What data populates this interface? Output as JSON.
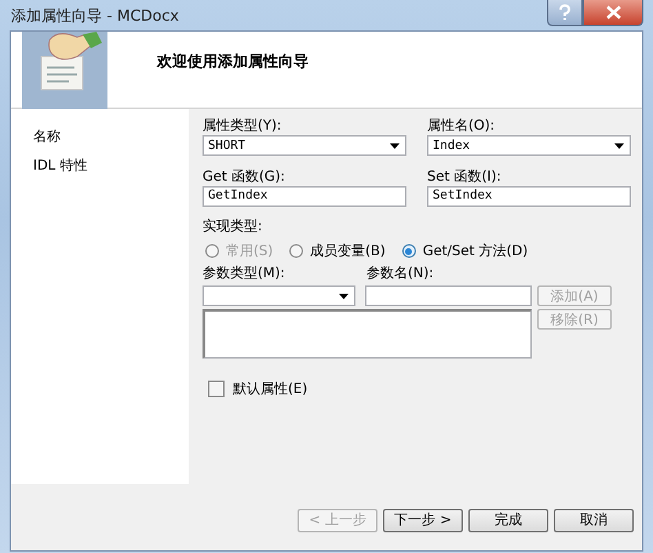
{
  "window": {
    "title": "添加属性向导 - MCDocx"
  },
  "header": {
    "title": "欢迎使用添加属性向导"
  },
  "sidebar": {
    "items": [
      {
        "label": "名称"
      },
      {
        "label": "IDL 特性"
      }
    ]
  },
  "property_type": {
    "label": "属性类型(Y):",
    "value": "SHORT"
  },
  "property_name": {
    "label": "属性名(O):",
    "value": "Index"
  },
  "get_function": {
    "label": "Get 函数(G):",
    "value": "GetIndex"
  },
  "set_function": {
    "label": "Set 函数(I):",
    "value": "SetIndex"
  },
  "implementation": {
    "label": "实现类型:",
    "options": [
      {
        "label": "常用(S)",
        "selected": false,
        "disabled": true
      },
      {
        "label": "成员变量(B)",
        "selected": false,
        "disabled": false
      },
      {
        "label": "Get/Set 方法(D)",
        "selected": true,
        "disabled": false
      }
    ]
  },
  "parameters": {
    "type_label": "参数类型(M):",
    "name_label": "参数名(N):",
    "add_button": {
      "label": "添加(A)",
      "disabled": true
    },
    "remove_button": {
      "label": "移除(R)",
      "disabled": true
    }
  },
  "default_property": {
    "label": "默认属性(E)",
    "checked": false
  },
  "buttons": [
    {
      "label": "< 上一步",
      "disabled": true
    },
    {
      "label": "下一步 >",
      "disabled": false
    },
    {
      "label": "完成",
      "disabled": false
    },
    {
      "label": "取消",
      "disabled": false
    }
  ]
}
